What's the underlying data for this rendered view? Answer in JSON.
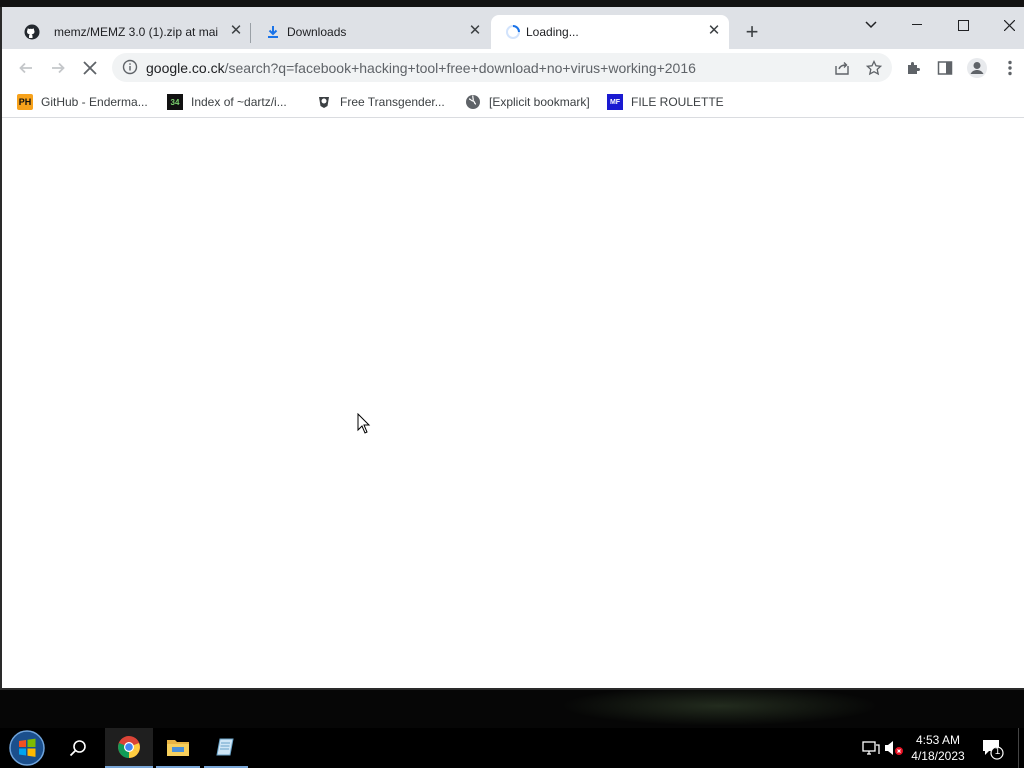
{
  "browser": {
    "tabs": [
      {
        "title": "memz/MEMZ 3.0 (1).zip at mai",
        "icon": "github-icon"
      },
      {
        "title": "Downloads",
        "icon": "download-icon"
      },
      {
        "title": "Loading...",
        "icon": "loading-spinner-icon"
      }
    ],
    "new_tab": "+",
    "url_domain": "google.co.ck",
    "url_path": "/search?q=facebook+hacking+tool+free+download+no+virus+working+2016"
  },
  "bookmarks": [
    {
      "label": "GitHub - Enderma...",
      "icon_text": "PH"
    },
    {
      "label": "Index of ~dartz/i...",
      "icon_text": "34"
    },
    {
      "label": "Free Transgender...",
      "icon_text": ""
    },
    {
      "label": "[Explicit bookmark]",
      "icon_text": ""
    },
    {
      "label": "FILE ROULETTE",
      "icon_text": "MF"
    }
  ],
  "taskbar": {
    "time": "4:53 AM",
    "date": "4/18/2023",
    "notification_count": "1"
  },
  "colors": {
    "accent": "#1a73e8",
    "tabstrip": "#dee1e6",
    "omnibox": "#f1f3f4"
  }
}
